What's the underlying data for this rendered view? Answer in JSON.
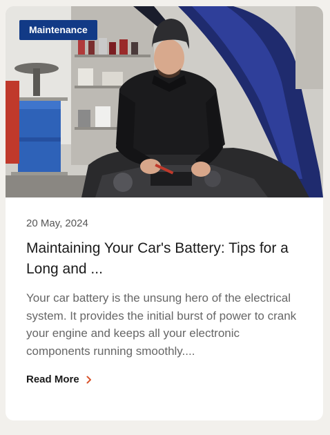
{
  "post": {
    "category": "Maintenance",
    "date": "20 May, 2024",
    "title": "Maintaining Your Car's Battery: Tips for a Long and ...",
    "excerpt": "Your car battery is the unsung hero of the electrical system. It provides the initial burst of power to crank your engine and keeps all your electronic components running smoothly....",
    "read_more_label": "Read More",
    "read_more_icon": "chevron-right-icon"
  },
  "colors": {
    "badge_bg": "#123a86",
    "accent": "#d9532b",
    "page_bg": "#f2f0ec",
    "card_bg": "#ffffff"
  }
}
